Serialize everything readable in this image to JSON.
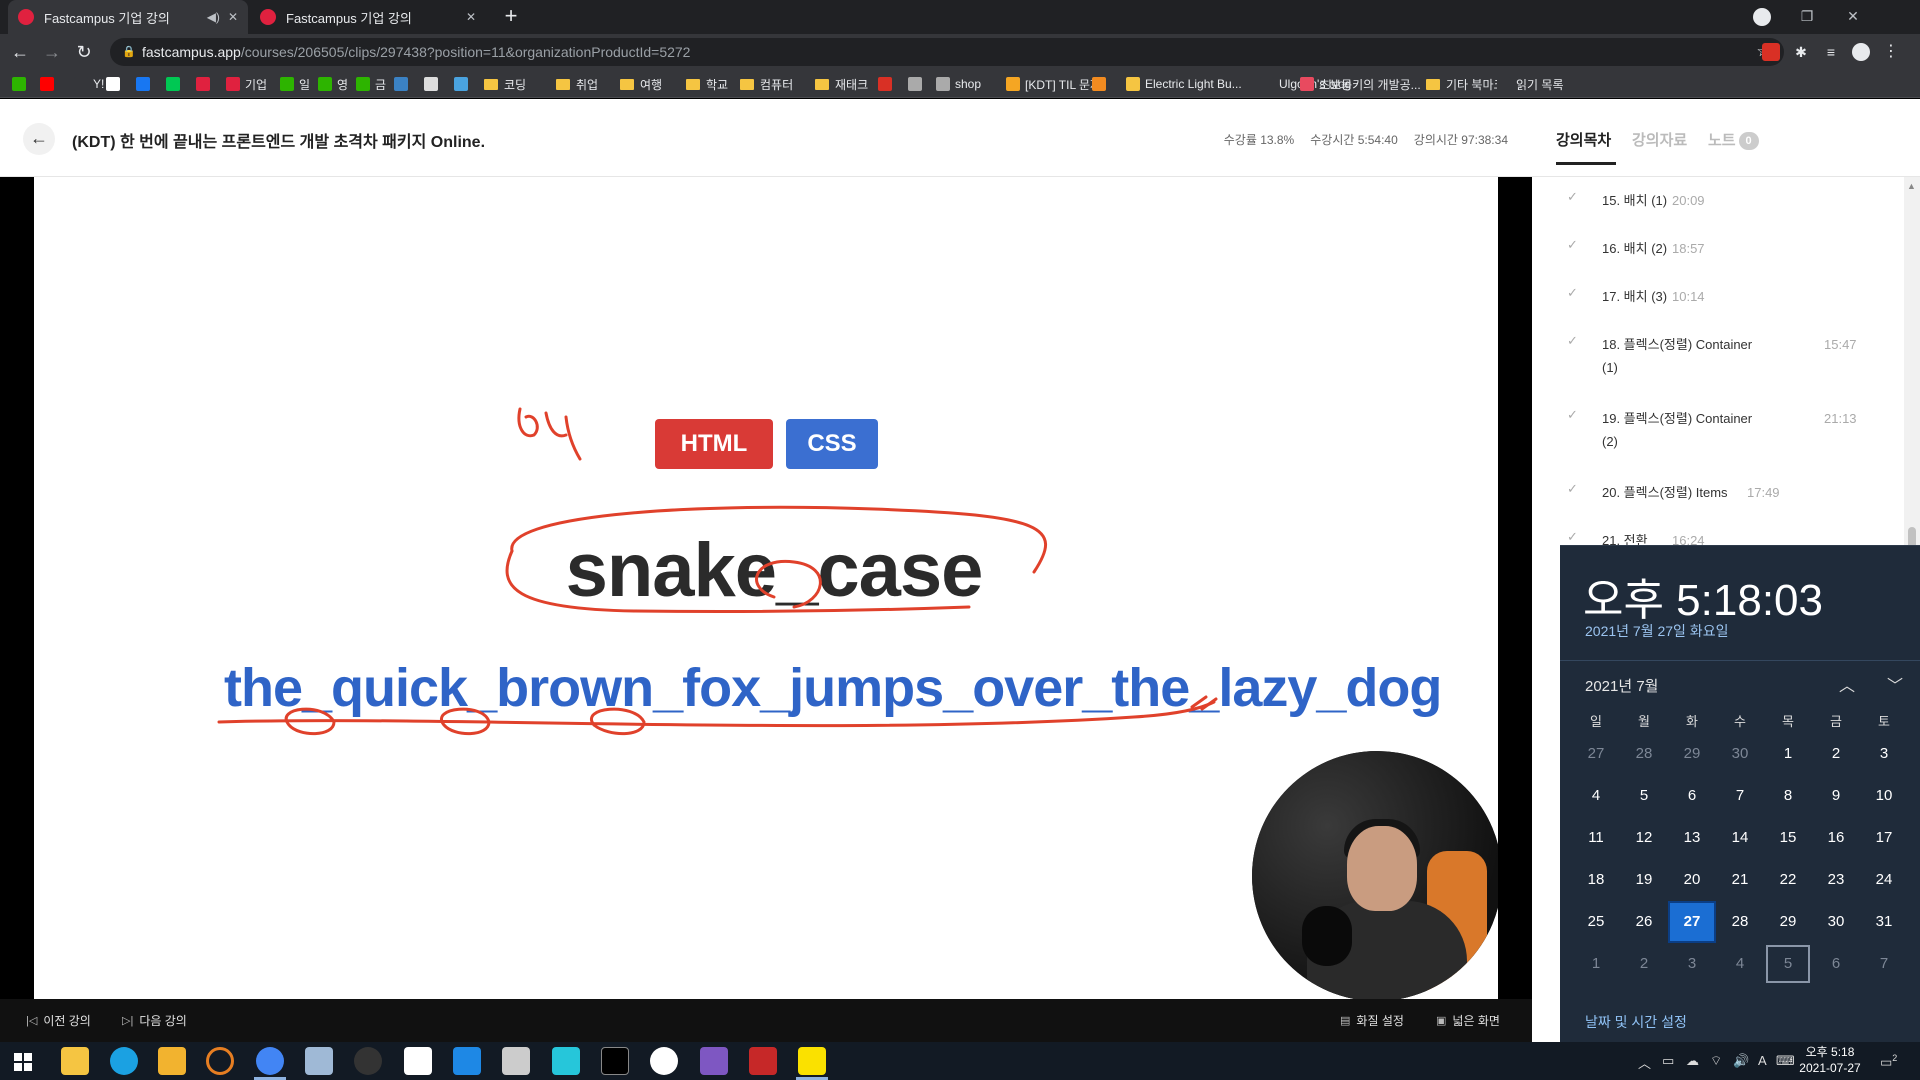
{
  "browser": {
    "tabs": [
      {
        "title": "Fastcampus 기업 강의",
        "mini": "◀)",
        "close": "✕"
      },
      {
        "title": "Fastcampus 기업 강의",
        "close": "✕"
      }
    ],
    "new_tab": "+",
    "url_host": "fastcampus.app",
    "url_path": "/courses/206505/clips/297438?position=11&organizationProductId=5272",
    "bookmarks": [
      {
        "label": "",
        "color": "#2db400"
      },
      {
        "label": "",
        "color": "#ff0000"
      },
      {
        "label": "Y!",
        "color": "#35363a"
      },
      {
        "label": "",
        "color": "#ffffff"
      },
      {
        "label": "",
        "color": "#1877f2"
      },
      {
        "label": "",
        "color": "#00c853"
      },
      {
        "label": "",
        "color": "#e0213f"
      },
      {
        "label": "기업",
        "color": "#e0213f"
      },
      {
        "label": "일",
        "color": "#2db400"
      },
      {
        "label": "영",
        "color": "#2db400"
      },
      {
        "label": "금",
        "color": "#2db400"
      },
      {
        "label": "",
        "color": "#3b82c4"
      },
      {
        "label": "",
        "color": "#dddddd"
      },
      {
        "label": "",
        "color": "#4aa3df"
      },
      {
        "label": "코딩",
        "folder": true
      },
      {
        "label": "취업",
        "folder": true
      },
      {
        "label": "여행",
        "folder": true
      },
      {
        "label": "학교",
        "folder": true
      },
      {
        "label": "컴퓨터",
        "folder": true
      },
      {
        "label": "재태크",
        "folder": true
      },
      {
        "label": "",
        "color": "#d93025"
      },
      {
        "label": "",
        "color": "#aaaaaa"
      },
      {
        "label": "shop",
        "color": "#aaaaaa"
      },
      {
        "label": "[KDT] TIL 문제",
        "color": "#f5a623"
      },
      {
        "label": "",
        "color": "#f28b20"
      },
      {
        "label": "Electric Light Bu...",
        "color": "#f5c542"
      },
      {
        "label": "Ulgoon's blog",
        "color": "#35363a",
        "glyph": "N"
      },
      {
        "label": "초보몽키의 개발공...",
        "color": "#e84a5f"
      },
      {
        "label": "기타 북마크",
        "folder": true
      },
      {
        "label": "읽기 목록",
        "color": "#35363a"
      }
    ]
  },
  "course": {
    "back": "←",
    "title": "(KDT) 한 번에 끝내는 프론트엔드 개발 초격차 패키지 Online.",
    "progress": "수강률 13.8%",
    "watched": "수강시간 5:54:40",
    "total": "강의시간 97:38:34"
  },
  "slide": {
    "badge_html": "HTML",
    "badge_css": "CSS",
    "heading": "snake_case",
    "example": "the_quick_brown_fox_jumps_over_the_lazy_dog",
    "handwriting": "뱀"
  },
  "player": {
    "prev": "이전 강의",
    "next": "다음 강의",
    "quality": "화질 설정",
    "wide": "넓은 화면"
  },
  "sidebar": {
    "tabs": {
      "toc": "강의목차",
      "materials": "강의자료",
      "notes": "노트",
      "note_count": "0"
    },
    "lessons": [
      {
        "title": "15. 배치 (1)",
        "duration": "20:09"
      },
      {
        "title": "16. 배치 (2)",
        "duration": "18:57"
      },
      {
        "title": "17. 배치 (3)",
        "duration": "10:14"
      },
      {
        "title": "18. 플렉스(정렬) Container (1)",
        "duration": "15:47"
      },
      {
        "title": "19. 플렉스(정렬) Container (2)",
        "duration": "21:13"
      },
      {
        "title": "20. 플렉스(정렬) Items",
        "duration": "17:49"
      },
      {
        "title": "21. 전환",
        "duration": "16:24"
      }
    ]
  },
  "clock_flyout": {
    "time": "오후 5:18:03",
    "date": "2021년 7월 27일 화요일",
    "month": "2021년 7월",
    "weekdays": [
      "일",
      "월",
      "화",
      "수",
      "목",
      "금",
      "토"
    ],
    "weeks": [
      [
        "27",
        "28",
        "29",
        "30",
        "1",
        "2",
        "3"
      ],
      [
        "4",
        "5",
        "6",
        "7",
        "8",
        "9",
        "10"
      ],
      [
        "11",
        "12",
        "13",
        "14",
        "15",
        "16",
        "17"
      ],
      [
        "18",
        "19",
        "20",
        "21",
        "22",
        "23",
        "24"
      ],
      [
        "25",
        "26",
        "27",
        "28",
        "29",
        "30",
        "31"
      ],
      [
        "1",
        "2",
        "3",
        "4",
        "5",
        "6",
        "7"
      ]
    ],
    "today": "27",
    "settings": "날짜 및 시간 설정"
  },
  "taskbar": {
    "clock_time": "오후 5:18",
    "clock_date": "2021-07-27",
    "ime": "A",
    "notification_count": "2"
  }
}
